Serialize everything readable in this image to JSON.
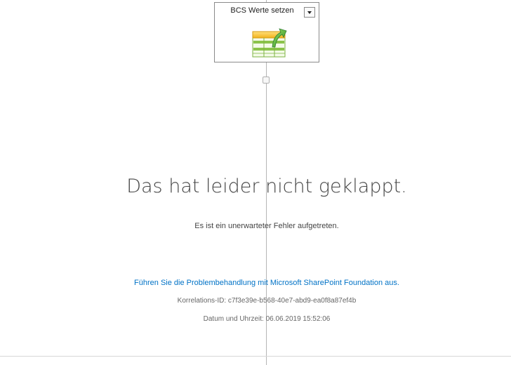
{
  "activity": {
    "title": "BCS Werte setzen",
    "icon": "bcs-table-upload-icon",
    "menu_icon": "chevron-down-icon"
  },
  "error": {
    "title": "Das hat leider nicht geklappt.",
    "subtitle": "Es ist ein unerwarteter Fehler aufgetreten.",
    "troubleshoot_link": "Führen Sie die Problembehandlung mit Microsoft SharePoint Foundation aus.",
    "correlation_label": "Korrelations-ID:",
    "correlation_id": "c7f3e39e-b568-40e7-abd9-ea0f8a87ef4b",
    "datetime_label": "Datum und Uhrzeit:",
    "datetime_value": "06.06.2019 15:52:06"
  },
  "colors": {
    "link": "#0072c6",
    "title_text": "#444444",
    "meta_text": "#666666",
    "connector": "#b5b5b5"
  }
}
